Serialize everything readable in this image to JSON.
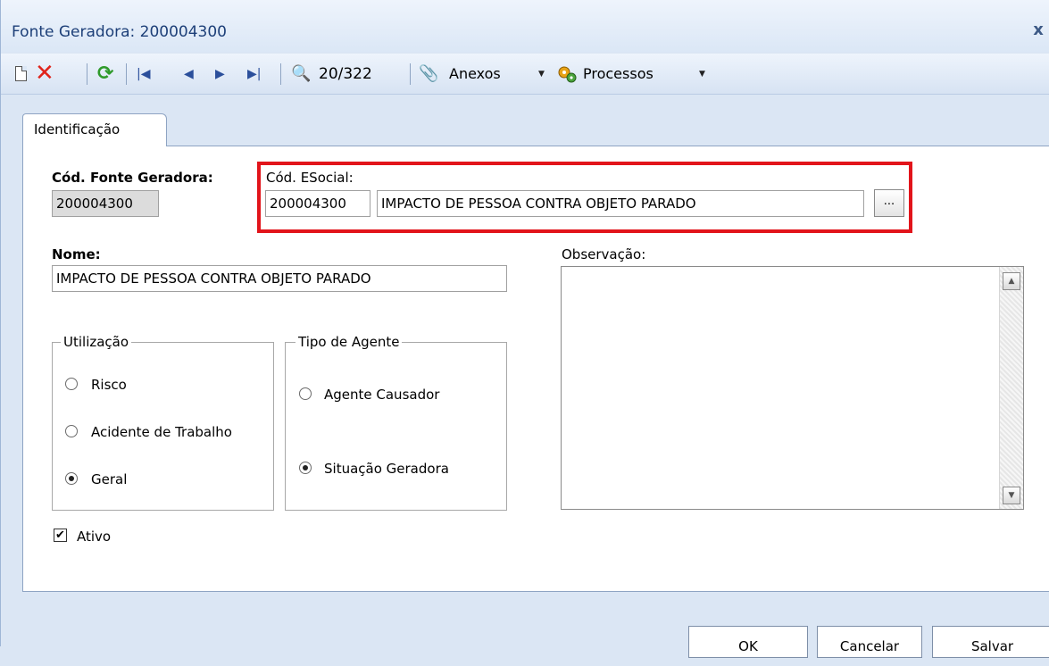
{
  "window": {
    "title": "Fonte Geradora: 200004300",
    "close_glyph": "x"
  },
  "toolbar": {
    "record_count": "20/322",
    "anexos_label": "Anexos",
    "processos_label": "Processos",
    "icons": [
      "new-icon",
      "delete-icon",
      "refresh-icon",
      "first-record-icon",
      "previous-record-icon",
      "next-record-icon",
      "last-record-icon",
      "find-icon",
      "attachment-icon",
      "processes-icon"
    ]
  },
  "tabs": [
    {
      "label": "Identificação",
      "active": true
    }
  ],
  "form": {
    "cod_fonte_label": "Cód. Fonte Geradora:",
    "cod_fonte_value": "200004300",
    "cod_esocial_label": "Cód. ESocial:",
    "cod_esocial_code": "200004300",
    "cod_esocial_desc": "IMPACTO DE PESSOA CONTRA OBJETO PARADO",
    "lookup_button": "...",
    "nome_label": "Nome:",
    "nome_value": "IMPACTO DE PESSOA CONTRA OBJETO PARADO",
    "observacao_label": "Observação:",
    "observacao_value": "",
    "utilizacao": {
      "title": "Utilização",
      "options": [
        {
          "label": "Risco",
          "checked": false
        },
        {
          "label": "Acidente de Trabalho",
          "checked": false
        },
        {
          "label": "Geral",
          "checked": true
        }
      ]
    },
    "tipo_agente": {
      "title": "Tipo de Agente",
      "options": [
        {
          "label": "Agente Causador",
          "checked": false
        },
        {
          "label": "Situação Geradora",
          "checked": true
        }
      ]
    },
    "ativo": {
      "label": "Ativo",
      "checked": true
    }
  },
  "buttons": {
    "ok": "OK",
    "cancel": "Cancelar",
    "save": "Salvar"
  },
  "colors": {
    "highlight": "#e2141b",
    "title_text": "#1d3f78",
    "delete": "#e0241b",
    "refresh": "#2f9a2b"
  }
}
